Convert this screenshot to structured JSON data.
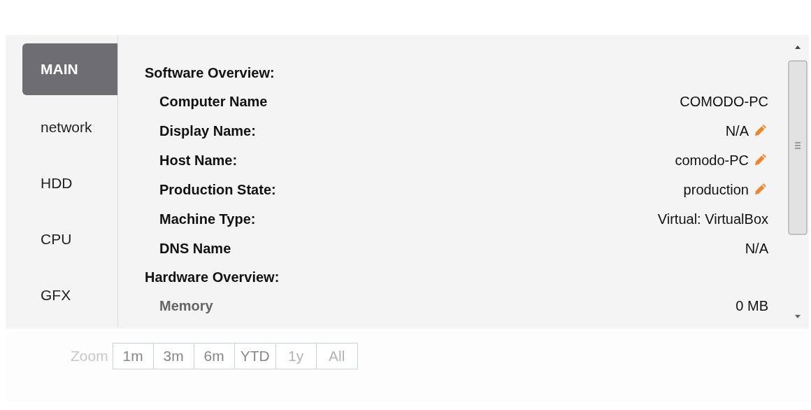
{
  "tabs": [
    {
      "label": "MAIN",
      "selected": true
    },
    {
      "label": "network",
      "selected": false
    },
    {
      "label": "HDD",
      "selected": false
    },
    {
      "label": "CPU",
      "selected": false
    },
    {
      "label": "GFX",
      "selected": false
    }
  ],
  "details": [
    {
      "kind": "heading",
      "label": "Software Overview:"
    },
    {
      "kind": "row",
      "label": "Computer Name",
      "value": "COMODO-PC",
      "editable": false,
      "muted": false
    },
    {
      "kind": "row",
      "label": "Display Name:",
      "value": "N/A",
      "editable": true,
      "muted": false
    },
    {
      "kind": "row",
      "label": "Host Name:",
      "value": "comodo-PC",
      "editable": true,
      "muted": false
    },
    {
      "kind": "row",
      "label": "Production State:",
      "value": "production",
      "editable": true,
      "muted": false
    },
    {
      "kind": "row",
      "label": "Machine Type:",
      "value": "Virtual: VirtualBox",
      "editable": false,
      "muted": false
    },
    {
      "kind": "row",
      "label": "DNS Name",
      "value": "N/A",
      "editable": false,
      "muted": false
    },
    {
      "kind": "heading",
      "label": "Hardware Overview:"
    },
    {
      "kind": "row",
      "label": "Memory",
      "value": "0 MB",
      "editable": false,
      "muted": true
    }
  ],
  "zoom": {
    "label": "Zoom",
    "buttons": [
      {
        "label": "1m",
        "disabled": false
      },
      {
        "label": "3m",
        "disabled": false
      },
      {
        "label": "6m",
        "disabled": false
      },
      {
        "label": "YTD",
        "disabled": false
      },
      {
        "label": "1y",
        "disabled": true
      },
      {
        "label": "All",
        "disabled": true
      }
    ]
  }
}
